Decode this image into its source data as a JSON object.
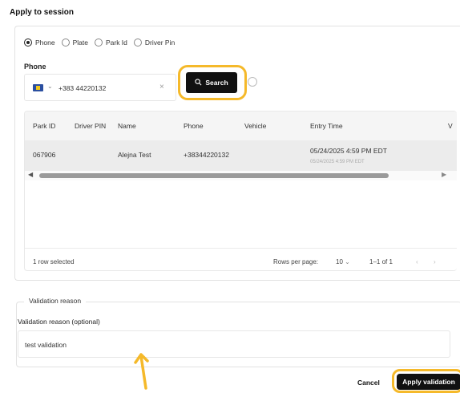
{
  "dialog": {
    "title": "Apply to session"
  },
  "search_by": {
    "options": [
      {
        "label": "Phone",
        "checked": true
      },
      {
        "label": "Plate",
        "checked": false
      },
      {
        "label": "Park Id",
        "checked": false
      },
      {
        "label": "Driver Pin",
        "checked": false
      }
    ]
  },
  "phone": {
    "label": "Phone",
    "country_flag": "kosovo-flag-icon",
    "value": "+383 44220132",
    "clear_icon": "×"
  },
  "search_button": {
    "label": "Search",
    "icon": "search-icon"
  },
  "table": {
    "columns": [
      "Park ID",
      "Driver PIN",
      "Name",
      "Phone",
      "Vehicle",
      "Entry Time",
      "V"
    ],
    "rows": [
      {
        "park_id": "067906",
        "driver_pin": "",
        "name": "Alejna Test",
        "phone": "+38344220132",
        "vehicle": "",
        "entry_time": "05/24/2025 4:59 PM EDT",
        "entry_time_sub": "05/24/2025 4:59 PM EDT"
      }
    ],
    "footer": {
      "selected": "1 row selected",
      "rows_per_page_label": "Rows per page:",
      "rows_per_page_value": "10",
      "range": "1–1 of 1"
    }
  },
  "validation": {
    "legend": "Validation reason",
    "field_label": "Validation reason (optional)",
    "value": "test validation"
  },
  "actions": {
    "cancel": "Cancel",
    "apply": "Apply validation"
  },
  "colors": {
    "highlight": "#f5b92a",
    "primary": "#111111"
  }
}
